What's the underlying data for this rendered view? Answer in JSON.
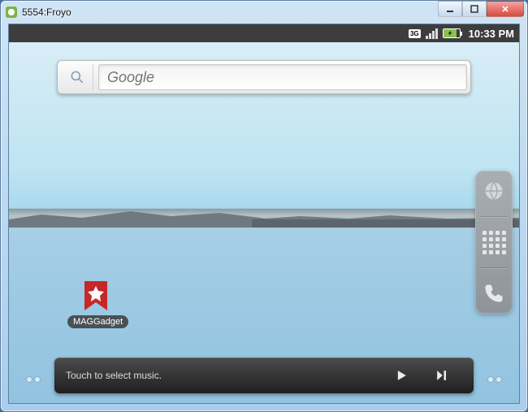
{
  "window": {
    "title": "5554:Froyo",
    "controls": {
      "min": "minimize",
      "max": "maximize",
      "close": "close"
    }
  },
  "statusbar": {
    "network_badge": "3G",
    "battery": {
      "charging_icon": "bolt"
    },
    "clock": "10:33 PM"
  },
  "search": {
    "placeholder": "Google",
    "value": ""
  },
  "tray": {
    "items": [
      {
        "name": "browser-icon"
      },
      {
        "name": "app-grid-icon"
      },
      {
        "name": "phone-icon"
      }
    ]
  },
  "shortcut": {
    "icon": "bookmark-star",
    "label": "MAGGadget"
  },
  "music": {
    "prompt": "Touch to select music.",
    "play_icon": "play",
    "next_icon": "next"
  }
}
